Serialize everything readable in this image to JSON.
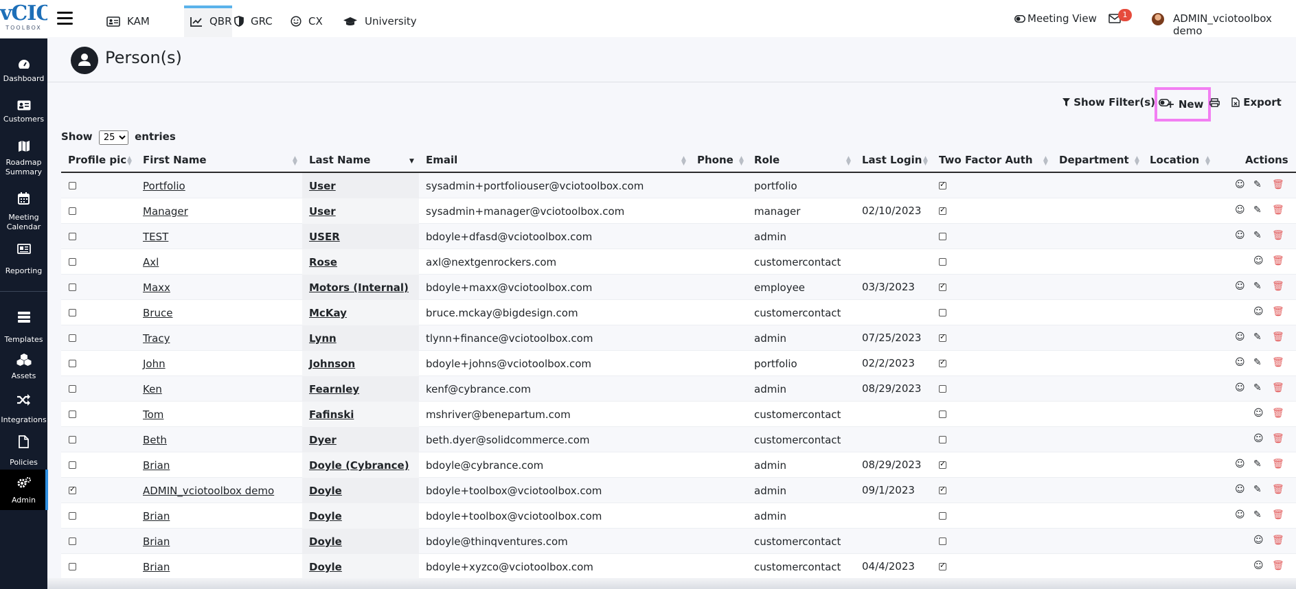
{
  "logo": {
    "main": "vCIO",
    "sub": "TOOLBOX"
  },
  "sidebar": [
    {
      "id": "dashboard",
      "label": "Dashboard",
      "icon": "dashboard-icon"
    },
    {
      "id": "customers",
      "label": "Customers",
      "icon": "customers-card-icon"
    },
    {
      "id": "roadmap",
      "label": "Roadmap Summary",
      "icon": "map-icon"
    },
    {
      "id": "calendar",
      "label": "Meeting Calendar",
      "icon": "calendar-icon"
    },
    {
      "id": "reporting",
      "label": "Reporting",
      "icon": "reporting-icon"
    },
    {
      "id": "templates",
      "label": "Templates",
      "icon": "templates-icon"
    },
    {
      "id": "assets",
      "label": "Assets",
      "icon": "assets-icon"
    },
    {
      "id": "integrations",
      "label": "Integrations",
      "icon": "shuffle-icon"
    },
    {
      "id": "policies",
      "label": "Policies",
      "icon": "document-icon"
    },
    {
      "id": "admin",
      "label": "Admin",
      "icon": "gears-icon"
    }
  ],
  "tabs": [
    {
      "label": "KAM",
      "icon": "id-card-icon"
    },
    {
      "label": "QBR",
      "icon": "chart-line-icon",
      "active": true
    },
    {
      "label": "GRC",
      "icon": "shield-icon"
    },
    {
      "label": "CX",
      "icon": "smile-icon"
    },
    {
      "label": "University",
      "icon": "graduation-cap-icon"
    }
  ],
  "header": {
    "meeting_view": "Meeting View",
    "notifications": "1",
    "user": "ADMIN_vciotoolbox demo"
  },
  "page": {
    "title": "Person(s)"
  },
  "toolbar": {
    "filters": "Show Filter(s)",
    "new": "New",
    "export": "Export",
    "show": "Show",
    "entries_value": "25",
    "entries": "entries"
  },
  "columns": [
    "Profile pic",
    "First Name",
    "Last Name",
    "Email",
    "Phone",
    "Role",
    "Last Login",
    "Two Factor Auth",
    "Department",
    "Location",
    "Actions"
  ],
  "rows": [
    {
      "first": "Portfolio",
      "last": "User",
      "email": "sysadmin+portfoliouser@vciotoolbox.com",
      "role": "portfolio",
      "login": "",
      "tfa": true,
      "selected": false,
      "actions": 3
    },
    {
      "first": "Manager",
      "last": "User",
      "email": "sysadmin+manager@vciotoolbox.com",
      "role": "manager",
      "login": "02/10/2023",
      "tfa": true,
      "selected": false,
      "actions": 3
    },
    {
      "first": "TEST",
      "last": "USER",
      "email": "bdoyle+dfasd@vciotoolbox.com",
      "role": "admin",
      "login": "",
      "tfa": false,
      "selected": false,
      "actions": 3
    },
    {
      "first": "Axl",
      "last": "Rose",
      "email": "axl@nextgenrockers.com",
      "role": "customercontact",
      "login": "",
      "tfa": false,
      "selected": false,
      "actions": 2
    },
    {
      "first": "Maxx",
      "last": "Motors (Internal)",
      "email": "bdoyle+maxx@vciotoolbox.com",
      "role": "employee",
      "login": "03/3/2023",
      "tfa": true,
      "selected": false,
      "actions": 3
    },
    {
      "first": "Bruce",
      "last": "McKay",
      "email": "bruce.mckay@bigdesign.com",
      "role": "customercontact",
      "login": "",
      "tfa": false,
      "selected": false,
      "actions": 2
    },
    {
      "first": "Tracy",
      "last": "Lynn",
      "email": "tlynn+finance@vciotoolbox.com",
      "role": "admin",
      "login": "07/25/2023",
      "tfa": true,
      "selected": false,
      "actions": 3
    },
    {
      "first": "John",
      "last": "Johnson",
      "email": "bdoyle+johns@vciotoolbox.com",
      "role": "portfolio",
      "login": "02/2/2023",
      "tfa": true,
      "selected": false,
      "actions": 3
    },
    {
      "first": "Ken",
      "last": "Fearnley",
      "email": "kenf@cybrance.com",
      "role": "admin",
      "login": "08/29/2023",
      "tfa": false,
      "selected": false,
      "actions": 3
    },
    {
      "first": "Tom",
      "last": "Fafinski",
      "email": "mshriver@benepartum.com",
      "role": "customercontact",
      "login": "",
      "tfa": false,
      "selected": false,
      "actions": 2
    },
    {
      "first": "Beth",
      "last": "Dyer",
      "email": "beth.dyer@solidcommerce.com",
      "role": "customercontact",
      "login": "",
      "tfa": false,
      "selected": false,
      "actions": 2
    },
    {
      "first": "Brian",
      "last": "Doyle (Cybrance)",
      "email": "bdoyle@cybrance.com",
      "role": "admin",
      "login": "08/29/2023",
      "tfa": true,
      "selected": false,
      "actions": 3
    },
    {
      "first": "ADMIN_vciotoolbox demo",
      "last": "Doyle",
      "email": "bdoyle+toolbox@vciotoolbox.com",
      "role": "admin",
      "login": "09/1/2023",
      "tfa": true,
      "selected": true,
      "actions": 3
    },
    {
      "first": "Brian",
      "last": "Doyle",
      "email": "bdoyle+toolbox@vciotoolbox.com",
      "role": "admin",
      "login": "",
      "tfa": false,
      "selected": false,
      "actions": 3
    },
    {
      "first": "Brian",
      "last": "Doyle",
      "email": "bdoyle@thinqventures.com",
      "role": "customercontact",
      "login": "",
      "tfa": false,
      "selected": false,
      "actions": 2
    },
    {
      "first": "Brian",
      "last": "Doyle",
      "email": "bdoyle+xyzco@vciotoolbox.com",
      "role": "customercontact",
      "login": "04/4/2023",
      "tfa": true,
      "selected": false,
      "actions": 2
    }
  ]
}
